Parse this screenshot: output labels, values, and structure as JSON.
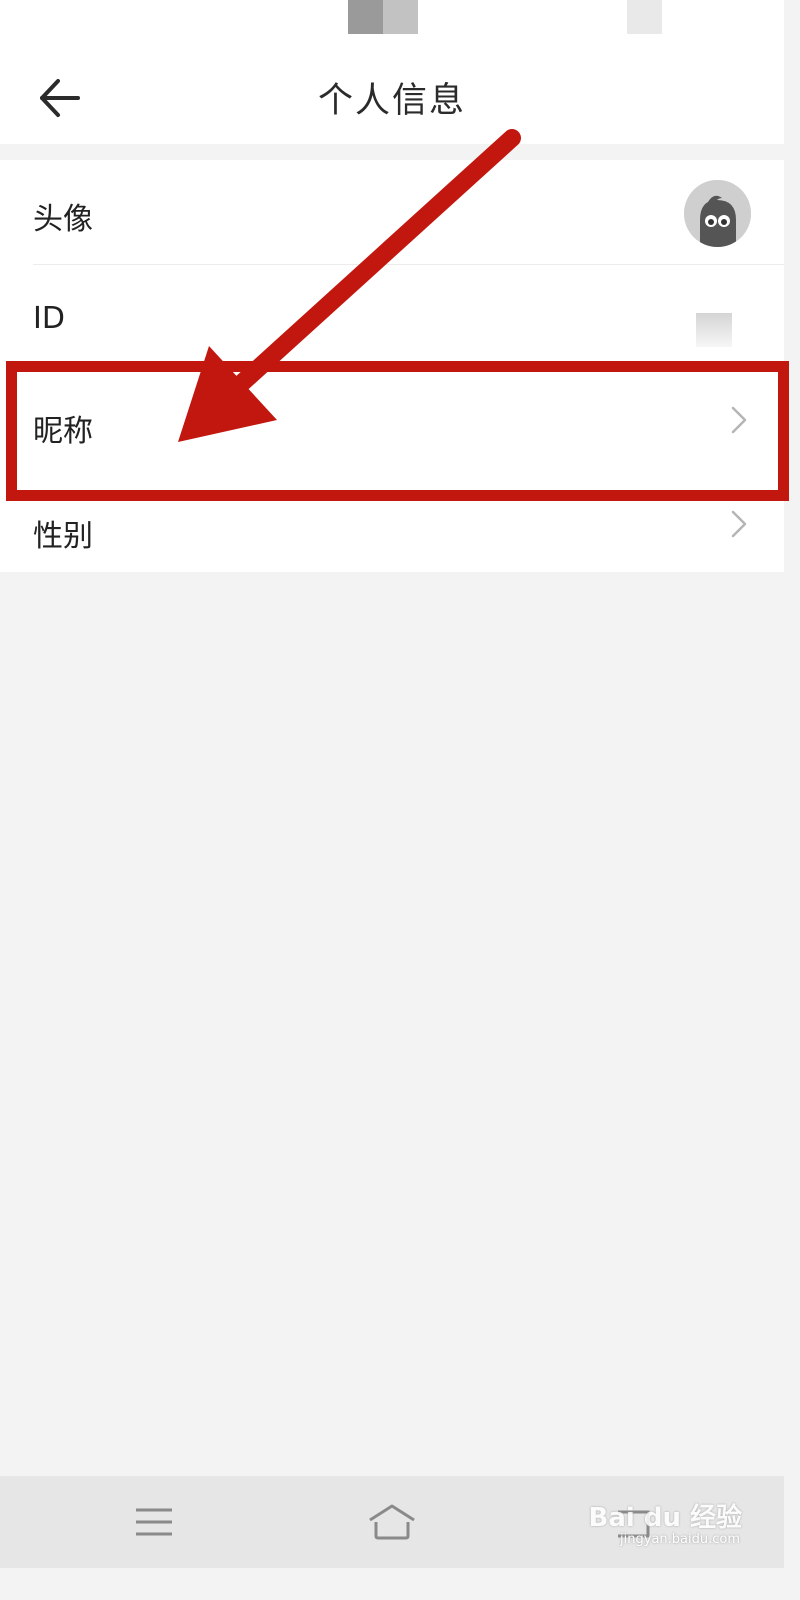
{
  "header": {
    "title": "个人信息",
    "back_icon": "arrow-left-icon"
  },
  "profile": {
    "rows": [
      {
        "label": "头像",
        "value_icon": "avatar-icon"
      },
      {
        "label": "ID",
        "value": ""
      },
      {
        "label": "昵称",
        "value": "",
        "trailing_icon": "chevron-right-icon"
      },
      {
        "label": "性别",
        "value": "",
        "trailing_icon": "chevron-right-icon"
      }
    ]
  },
  "annotation": {
    "color": "#c2170f",
    "target": "昵称"
  },
  "bottom_nav": {
    "items": [
      "menu-icon",
      "home-icon",
      "back-icon"
    ]
  },
  "watermark": {
    "text": "Bai du 经验",
    "subtext": "jingyan.baidu.com"
  },
  "colors": {
    "page_bg": "#f3f3f3",
    "card_bg": "#ffffff",
    "nav_bg": "#e6e6e6",
    "highlight": "#c2170f"
  }
}
